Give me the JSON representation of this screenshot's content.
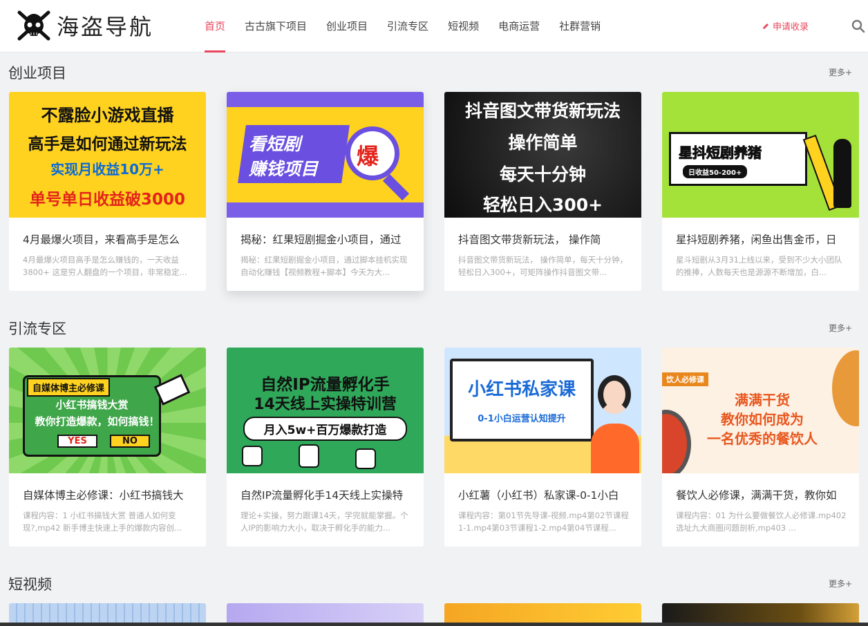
{
  "header": {
    "logo_text": "海盗导航",
    "nav": [
      "首页",
      "古古旗下项目",
      "创业项目",
      "引流专区",
      "短视频",
      "电商运营",
      "社群营销"
    ],
    "apply_label": "申请收录"
  },
  "sections": [
    {
      "title": "创业项目",
      "more": "更多+",
      "cards": [
        {
          "thumb_lines": [
            "不露脸小游戏直播",
            "高手是如何通过新玩法",
            "实现月收益10万+",
            "单号单日收益破3000"
          ],
          "title": "4月最爆火项目，来看高手是怎么",
          "desc": "4月最爆火项目高手是怎么赚钱的，一天收益3800+ 这是穷人翻盘的一个项目，非常稳定..."
        },
        {
          "thumb_lines": [
            "看短剧",
            "赚钱项目",
            "爆"
          ],
          "title": "揭秘：红果短剧掘金小项目，通过",
          "desc": "揭秘：红果短剧掘金小项目，通过脚本挂机实现自动化赚钱【视频教程+脚本】今天为大..."
        },
        {
          "thumb_lines": [
            "抖音图文带货新玩法",
            "操作简单",
            "每天十分钟",
            "轻松日入300+"
          ],
          "title": "抖音图文带货新玩法， 操作简",
          "desc": "抖音图文带货新玩法， 操作简单，每天十分钟，轻松日入300+，可矩阵操作抖音图文带..."
        },
        {
          "thumb_lines": [
            "星抖短剧养猪",
            "日收益50-200+"
          ],
          "title": "星抖短剧养猪，闲鱼出售金币，日",
          "desc": "星斗短剧从3月31上线以来，受到不少大小团队的推捧，人数每天也是源源不断增加，白..."
        }
      ]
    },
    {
      "title": "引流专区",
      "more": "更多+",
      "cards": [
        {
          "thumb_lines": [
            "自媒体博主必修课",
            "小红书搞钱大赏",
            "教你打造爆款，如何搞钱！",
            "YES",
            "NO"
          ],
          "title": "自媒体博主必修课：小红书搞钱大",
          "desc": "课程内容：1 小红书搞钱大赏 普通人如何变现?,mp42 新手博主快速上手的爆款内容创..."
        },
        {
          "thumb_lines": [
            "自然IP流量孵化手",
            "14天线上实操特训营",
            "月入5w+百万爆款打造"
          ],
          "title": "自然IP流量孵化手14天线上实操特",
          "desc": "理论+实操，努力跟课14天，学完就能掌握。个人IP的影响力大小，取决于孵化手的能力..."
        },
        {
          "thumb_lines": [
            "小红书私家课",
            "0-1小白运营认知提升"
          ],
          "title": "小红薯（小红书）私家课-0-1小白",
          "desc": "课程内容：第01节先导课-视频.mp4第02节课程1-1.mp4第03节课程1-2.mp4第04节课程..."
        },
        {
          "thumb_lines": [
            "饮人必修课",
            "满满干货",
            "教你如何成为",
            "一名优秀的餐饮人"
          ],
          "title": "餐饮人必修课，满满干货，教你如",
          "desc": "课程内容：01 为什么要做餐饮人必修课.mp402 选址九大商圈问题剖析,mp403 ..."
        }
      ]
    },
    {
      "title": "短视频",
      "more": "更多+"
    }
  ],
  "colors": {
    "accent": "#e8465a"
  }
}
